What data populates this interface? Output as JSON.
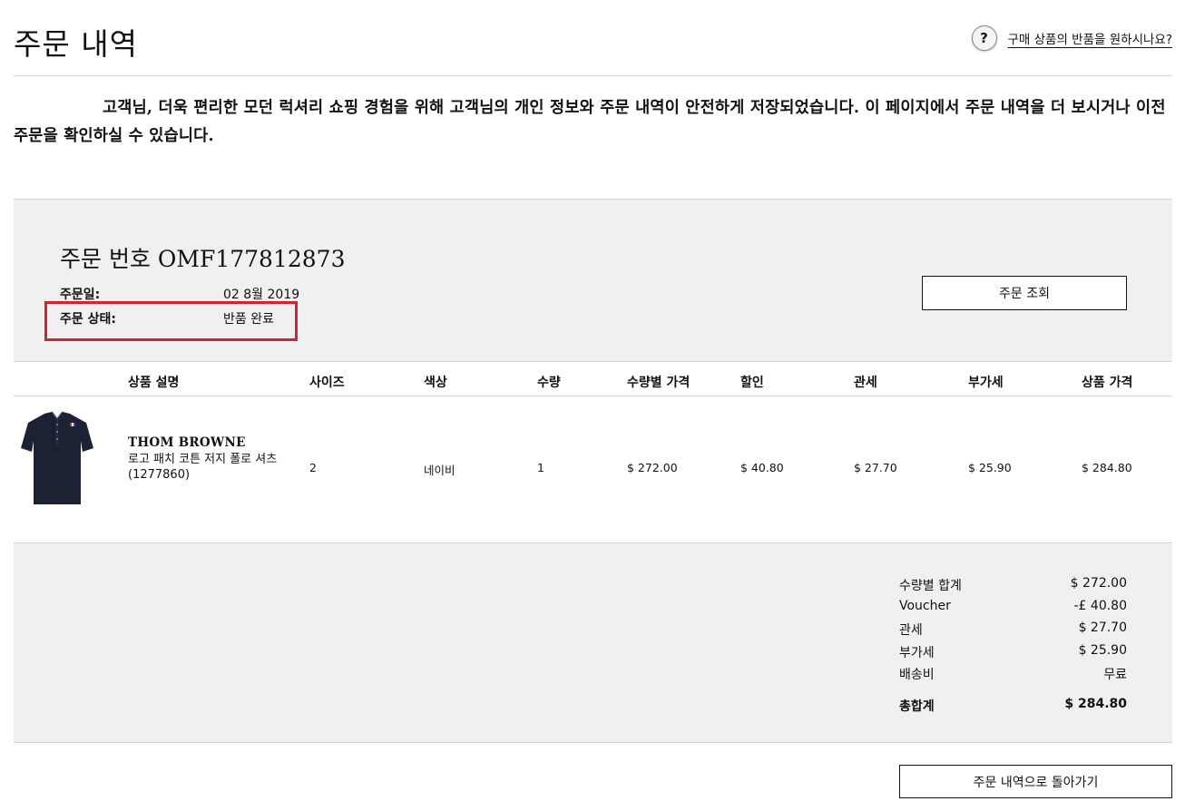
{
  "page": {
    "title": "주문 내역",
    "help_link": "구매 상품의 반품을 원하시나요?",
    "intro_text": "고객님, 더욱 편리한 모던 럭셔리 쇼핑 경험을 위해 고객님의 개인 정보와 주문 내역이 안전하게 저장되었습니다. 이 페이지에서 주문 내역을 더 보시거나 이전 주문을 확인하실 수 있습니다."
  },
  "order": {
    "number_label": "주문 번호 OMF177812873",
    "date_label": "주문일:",
    "date_value": "02 8월 2019",
    "status_label": "주문 상태:",
    "status_value": "반품 완료",
    "highlight_color": "#d2242d",
    "track_button": "주문 조회"
  },
  "table": {
    "headers": [
      "상품 설명",
      "사이즈",
      "색상",
      "수량",
      "수량별 가격",
      "할인",
      "관세",
      "부가세",
      "상품 가격"
    ],
    "items": [
      {
        "brand": "THOM BROWNE",
        "name": "로고 패치 코튼 저지 폴로 셔츠",
        "code": "(1277860)",
        "size": "2",
        "color": "네이비",
        "quantity": "1",
        "unit_price": "$ 272.00",
        "discount": "$ 40.80",
        "duty": "$ 27.70",
        "vat": "$ 25.90",
        "total": "$ 284.80",
        "image_icon": "navy-polo-shirt"
      }
    ]
  },
  "totals": [
    {
      "label": "수량별 합계",
      "value": "$ 272.00"
    },
    {
      "label": "Voucher",
      "value": "-£ 40.80"
    },
    {
      "label": "관세",
      "value": "$ 27.70"
    },
    {
      "label": "부가세",
      "value": "$ 25.90"
    },
    {
      "label": "배송비",
      "value": "무료"
    }
  ],
  "grand_total": {
    "label": "총합계",
    "value": "$ 284.80"
  },
  "back_button": "주문 내역으로 돌아가기"
}
